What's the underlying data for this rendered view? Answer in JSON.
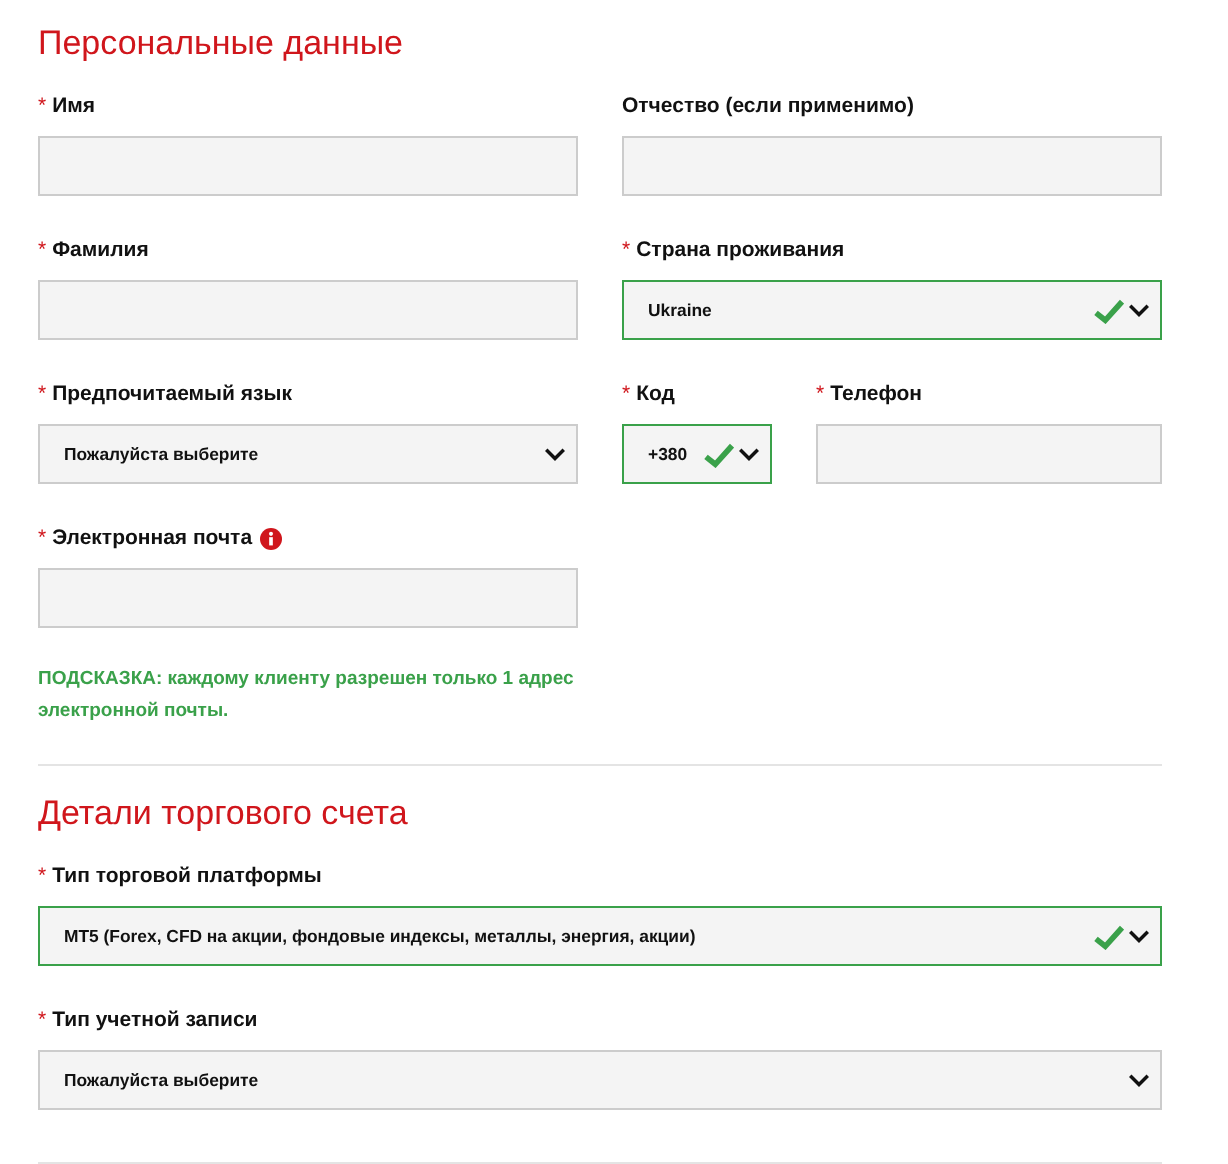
{
  "sections": [
    {
      "title": "Персональные данные",
      "rows": [
        [
          {
            "kind": "text",
            "label": "Имя",
            "required_mark": "*",
            "valid": false
          },
          {
            "kind": "text",
            "label": "Отчество (если применимо)",
            "valid": false
          }
        ],
        [
          {
            "kind": "text",
            "label": "Фамилия",
            "required_mark": "*",
            "valid": false
          },
          {
            "kind": "select",
            "label": "Страна проживания",
            "required_mark": "*",
            "value": "Ukraine",
            "valid": true
          }
        ],
        [
          {
            "kind": "select",
            "label": "Предпочитаемый язык",
            "required_mark": "*",
            "value": "Пожалуйста выберите",
            "valid": false
          },
          {
            "kind": "select",
            "label": "Код",
            "required_mark": "*",
            "value": "+380",
            "valid": true
          },
          {
            "kind": "text",
            "label": "Телефон",
            "required_mark": "*",
            "valid": false
          }
        ],
        [
          {
            "kind": "text",
            "label": "Электронная почта",
            "required_mark": "*",
            "valid": false,
            "info": true,
            "hint": "ПОДСКАЗКА: каждому клиенту разрешен только 1 адрес электронной почты."
          }
        ]
      ]
    },
    {
      "title": "Детали торгового счета",
      "rows": [
        [
          {
            "kind": "select",
            "label": "Тип торговой платформы",
            "required_mark": "*",
            "value": "MT5 (Forex, CFD на акции, фондовые индексы, металлы, энергия, акции)",
            "valid": true
          }
        ],
        [
          {
            "kind": "select",
            "label": "Тип учетной записи",
            "required_mark": "*",
            "value": "Пожалуйста выберите",
            "valid": false
          }
        ]
      ]
    }
  ]
}
